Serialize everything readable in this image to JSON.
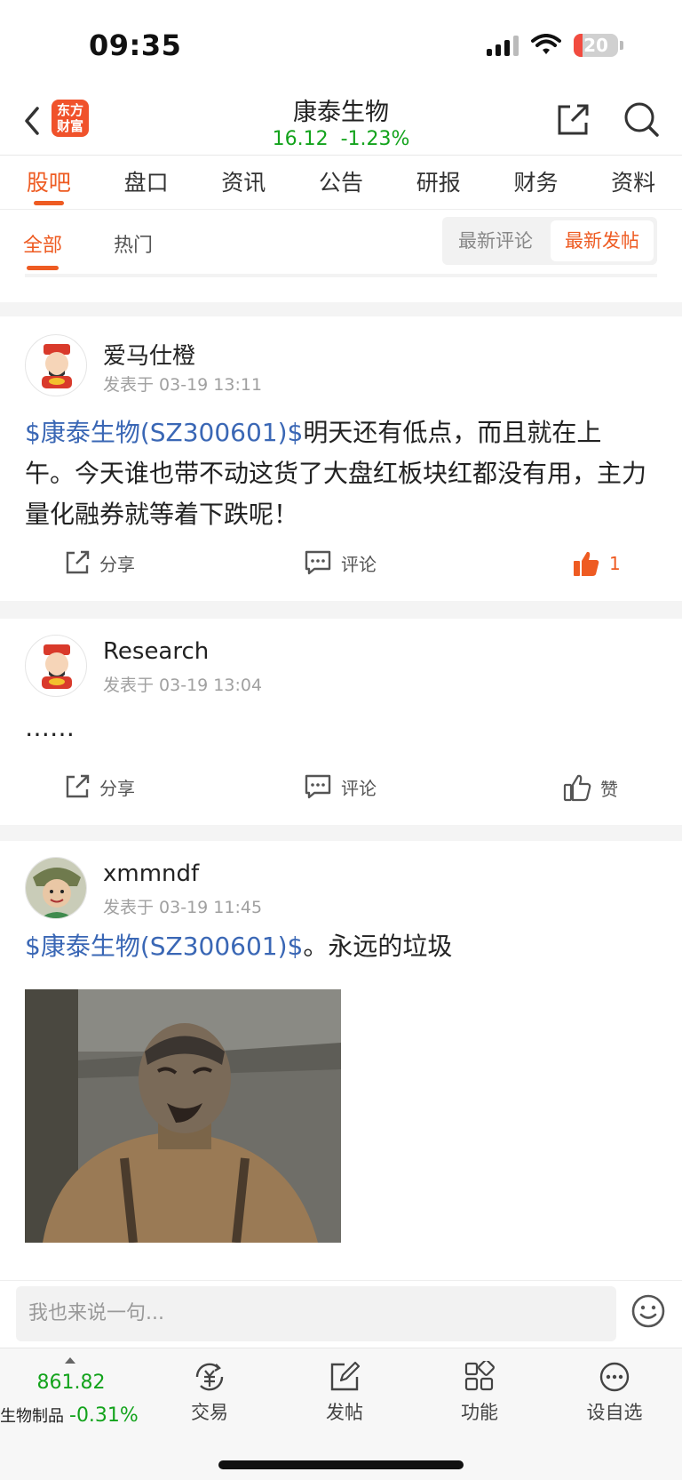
{
  "status_bar": {
    "time": "09:35",
    "battery": "20"
  },
  "header": {
    "logo_text": "东方财富",
    "stock_name": "康泰生物",
    "price": "16.12",
    "change": "-1.23%"
  },
  "main_tabs": [
    "股吧",
    "盘口",
    "资讯",
    "公告",
    "研报",
    "财务",
    "资料"
  ],
  "sub_tabs": {
    "all": "全部",
    "hot": "热门"
  },
  "sort": {
    "latest_comment": "最新评论",
    "latest_post": "最新发帖"
  },
  "posts": [
    {
      "username": "爱马仕橙",
      "time": "发表于 03-19 13:11",
      "stock_link": "$康泰生物(SZ300601)$",
      "text": "明天还有低点，而且就在上午。今天谁也带不动这货了大盘红板块红都没有用，主力量化融券就等着下跌呢！",
      "share": "分享",
      "comment": "评论",
      "likes": "1"
    },
    {
      "username": "Research",
      "time": "发表于 03-19 13:04",
      "text": "……",
      "share": "分享",
      "comment": "评论",
      "like": "赞"
    },
    {
      "username": "xmmndf",
      "time": "发表于 03-19 11:45",
      "stock_link": "$康泰生物(SZ300601)$",
      "text": "。永远的垃圾"
    }
  ],
  "comment_bar": {
    "placeholder": "我也来说一句..."
  },
  "bottom_nav": {
    "index_value": "861.82",
    "index_name": "生物制品",
    "index_change": "-0.31%",
    "trade": "交易",
    "post": "发帖",
    "function": "功能",
    "watchlist": "设自选"
  },
  "colors": {
    "accent": "#ee5b22",
    "down": "#13a31c",
    "link": "#3a67b5"
  }
}
